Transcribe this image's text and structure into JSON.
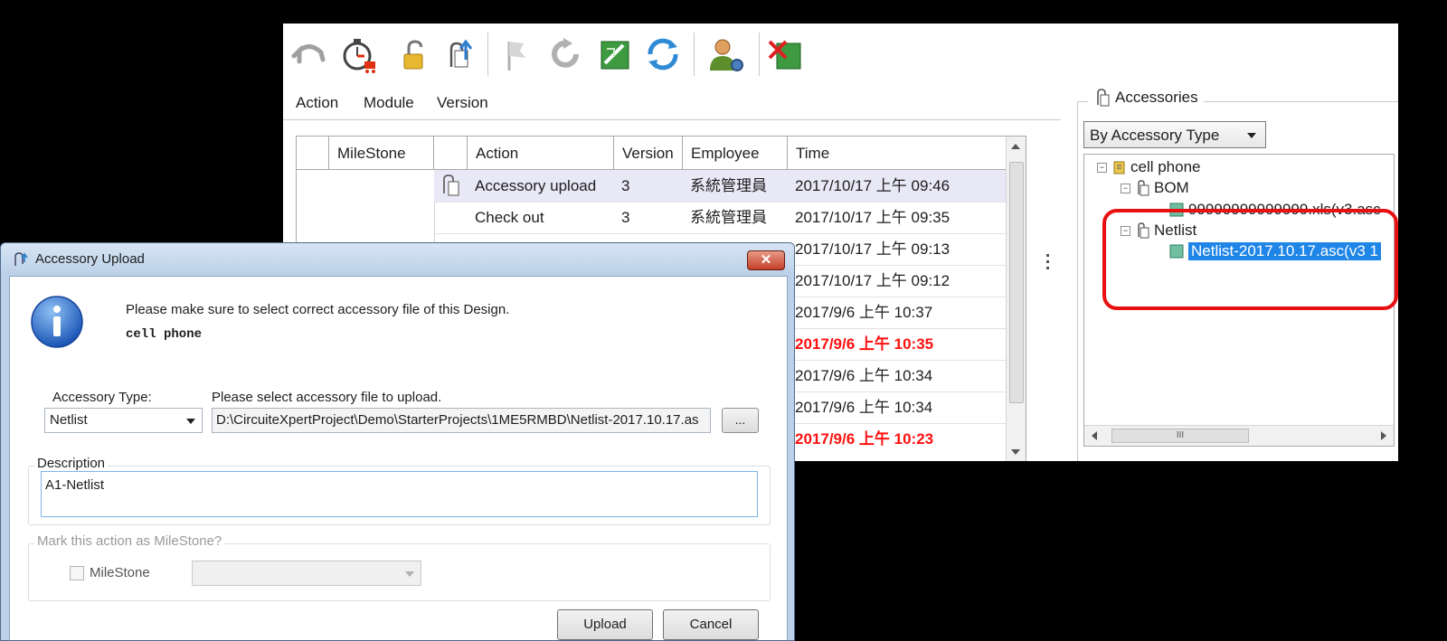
{
  "tabs": [
    "Action",
    "Module",
    "Version"
  ],
  "grid": {
    "headers": [
      "MileStone",
      "Action",
      "Version",
      "Employee",
      "Time"
    ],
    "rows": [
      {
        "action": "Accessory upload",
        "version": "3",
        "employee": "系統管理員",
        "time": "2017/10/17 上午 09:46",
        "selected": true,
        "icon": "paperclip-doc-icon"
      },
      {
        "action": "Check out",
        "version": "3",
        "employee": "系統管理員",
        "time": "2017/10/17 上午 09:35"
      },
      {
        "time": "2017/10/17 上午 09:13"
      },
      {
        "time": "2017/10/17 上午 09:12"
      },
      {
        "time": "2017/9/6 上午 10:37"
      },
      {
        "time": "2017/9/6 上午 10:35",
        "highlight": true
      },
      {
        "time": "2017/9/6 上午 10:34"
      },
      {
        "time": "2017/9/6 上午 10:34"
      },
      {
        "time": "2017/9/6 上午 10:23",
        "highlight": true
      }
    ]
  },
  "accessories": {
    "title": "Accessories",
    "filter": "By Accessory Type",
    "tree": {
      "root": "cell phone",
      "bom": "BOM",
      "bom_file": "99999999999999.xls(v3.asc",
      "netlist": "Netlist",
      "netlist_file": "Netlist-2017.10.17.asc(v3 1"
    },
    "scroll_label": "III"
  },
  "dialog": {
    "title": "Accessory Upload",
    "close": "✕",
    "message": "Please make sure to select correct accessory file of this Design.",
    "design": "cell phone",
    "type_label": "Accessory Type:",
    "type_value": "Netlist",
    "file_label": "Please select accessory file to upload.",
    "file_path": "D:\\CircuiteXpertProject\\Demo\\StarterProjects\\1ME5RMBD\\Netlist-2017.10.17.as",
    "browse": "...",
    "desc_legend": "Description",
    "desc_value": "A1-Netlist",
    "ms_legend": "Mark this action as MileStone?",
    "ms_checkbox": "MileStone",
    "upload": "Upload",
    "cancel": "Cancel"
  },
  "colors": {
    "highlight_text": "#ff1010",
    "tree_selection": "#1f86e8",
    "callout": "#e81010"
  }
}
